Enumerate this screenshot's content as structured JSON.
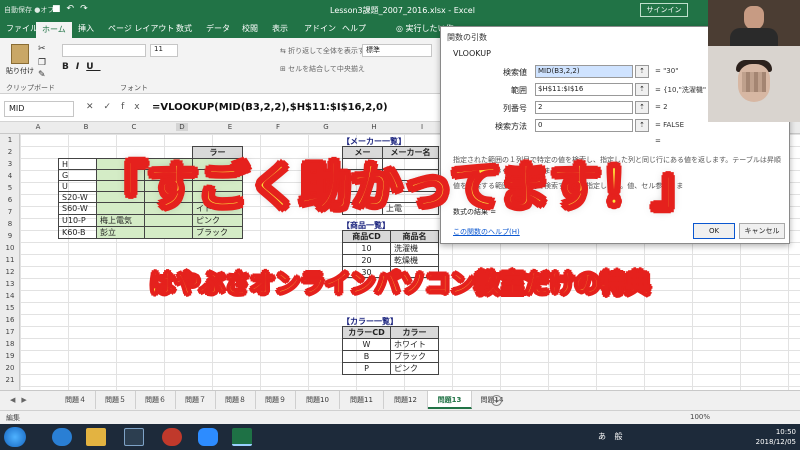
{
  "app": {
    "autosave_label": "自動保存 ●オフ",
    "document_title": "Lesson3課題_2007_2016.xlsx - Excel",
    "signin_label": "サインイン"
  },
  "ribbon_tabs": [
    "ファイル",
    "ホーム",
    "挿入",
    "ページ レイアウト",
    "数式",
    "データ",
    "校閲",
    "表示",
    "アドイン",
    "ヘルプ"
  ],
  "tell_me": "実行したい作",
  "ribbon": {
    "paste_label": "貼り付け",
    "clipboard_label": "クリップボード",
    "font_label": "フォント",
    "font_size": "11",
    "wrap_label": "折り返して全体を表示する",
    "merge_label": "セルを結合して中央揃え",
    "number_format": "標準"
  },
  "formula_bar": {
    "name_box": "MID",
    "formula": "=VLOOKUP(MID(B3,2,2),$H$11:$I$16,2,0)"
  },
  "columns": [
    "A",
    "B",
    "C",
    "D",
    "E",
    "F",
    "G",
    "H",
    "I"
  ],
  "rows": [
    "1",
    "2",
    "3",
    "4",
    "5",
    "6",
    "7",
    "8",
    "9",
    "10",
    "11",
    "12",
    "13",
    "14",
    "15",
    "16",
    "17",
    "18",
    "19",
    "20",
    "21"
  ],
  "left_table": {
    "partial_codes": [
      "H",
      "G",
      "U",
      "S20-W",
      "S60-W",
      "U10-P",
      "K60-B"
    ],
    "col_c": [
      "",
      "",
      "",
      "",
      "",
      "梅上電気",
      "彭立"
    ],
    "col_e_header": "ラー",
    "col_e": [
      "",
      "",
      "",
      "",
      "イト",
      "ピンク",
      "ブラック"
    ]
  },
  "maker_table": {
    "title": "【メーカー一覧】",
    "headers": [
      "メー",
      "メーカー名"
    ],
    "partial": "上電"
  },
  "product_table": {
    "title": "【商品一覧】",
    "headers": [
      "商品CD",
      "商品名"
    ],
    "rows": [
      [
        "10",
        "洗濯機"
      ],
      [
        "20",
        "乾燥機"
      ],
      [
        "30",
        ""
      ]
    ]
  },
  "color_table": {
    "title": "【カラー一覧】",
    "headers": [
      "カラーCD",
      "カラー"
    ],
    "rows": [
      [
        "W",
        "ホワイト"
      ],
      [
        "B",
        "ブラック"
      ],
      [
        "P",
        "ピンク"
      ]
    ]
  },
  "dialog": {
    "title": "関数の引数",
    "function_name": "VLOOKUP",
    "args": [
      {
        "label": "検索値",
        "value": "MID(B3,2,2)",
        "result": "= \"30\""
      },
      {
        "label": "範囲",
        "value": "$H$11:$I$16",
        "result": "= {10,\"洗濯機\""
      },
      {
        "label": "列番号",
        "value": "2",
        "result": "= 2"
      },
      {
        "label": "検索方法",
        "value": "0",
        "result": "= FALSE"
      }
    ],
    "description": "指定された範囲の１列目で特定の値を検索し、指定した列と同じ行にある値を返します。テーブルは昇順で並べ替えておく必要があります。",
    "description2": "値を検索する範囲の先頭列で検索する値を指定します。値、セル参照、ま",
    "result_label": "数式の結果 =",
    "help_link": "この関数のヘルプ(H)",
    "ok": "OK",
    "cancel": "キャンセル",
    "equals": "="
  },
  "overlay": {
    "headline": "「すごく助かってます！」",
    "subline": "はやぶさオンラインパソコン教室だけの特典"
  },
  "sheet_tabs": [
    "問題４",
    "問題５",
    "問題６",
    "問題７",
    "問題８",
    "問題９",
    "問題10",
    "問題11",
    "問題12",
    "問題13",
    "問題14"
  ],
  "active_sheet_index": 9,
  "status": {
    "mode": "編集",
    "zoom": "100%"
  },
  "taskbar": {
    "tray": "あ 般",
    "time": "10:50",
    "date": "2018/12/05"
  },
  "colors": {
    "excel_green": "#217346",
    "headline_fill": "#ffe33a",
    "headline_stroke": "#e5211d",
    "table_green": "#d4ecc6"
  }
}
